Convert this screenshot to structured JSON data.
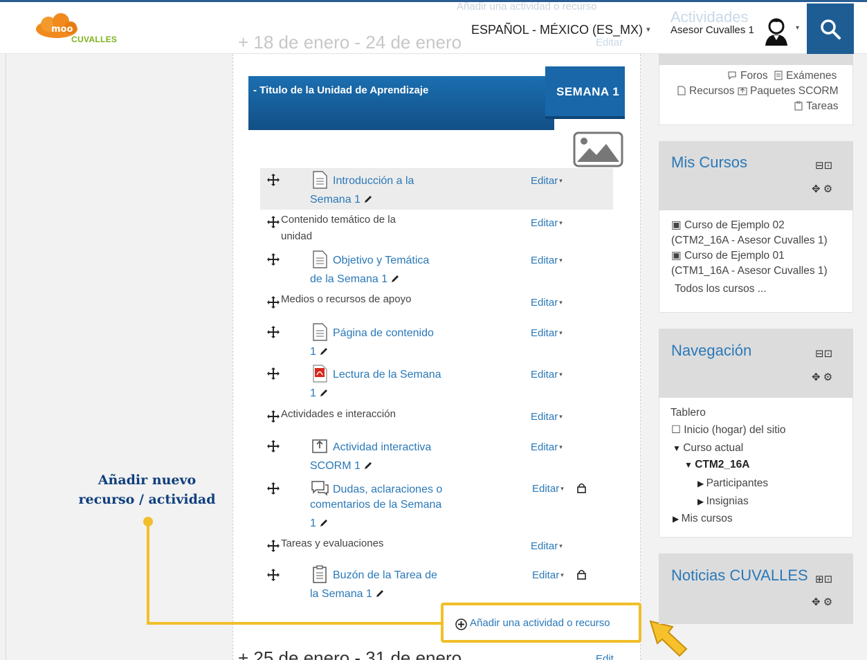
{
  "header": {
    "logo_text": "CUVALLES",
    "logo_badge": "moo",
    "language": "ESPAÑOL - MÉXICO (ES_MX)",
    "user_name": "Asesor Cuvalles 1",
    "faded_block_title": "Actividades",
    "faded_add_text": "Añadir una actividad o recurso"
  },
  "course": {
    "previous_week": "+ 18 de enero - 24 de enero",
    "previous_week_edit": "Editar",
    "unit_title": "- Titulo de la Unidad de Aprendizaje",
    "week_label": "SEMANA 1",
    "items": [
      {
        "kind": "resource",
        "line1": "Introducción a la",
        "line2": "Semana 1",
        "edit": "Editar"
      },
      {
        "kind": "label",
        "line1": "Contenido temático de la",
        "line2": "unidad",
        "edit": "Editar"
      },
      {
        "kind": "resource",
        "line1": "Objetivo y Temática",
        "line2": "de la Semana 1",
        "edit": "Editar"
      },
      {
        "kind": "label",
        "line1": "Medios o recursos de apoyo",
        "edit": "Editar"
      },
      {
        "kind": "resource",
        "line1": "Página de contenido",
        "line2": "1",
        "edit": "Editar"
      },
      {
        "kind": "resource",
        "line1": "Lectura de la Semana",
        "line2": "1",
        "edit": "Editar"
      },
      {
        "kind": "label",
        "line1": "Actividades e interacción",
        "edit": "Editar"
      },
      {
        "kind": "resource",
        "line1": "Actividad interactiva",
        "line2": "SCORM 1",
        "edit": "Editar"
      },
      {
        "kind": "resource",
        "line1": "Dudas, aclaraciones o",
        "line2": "comentarios de la Semana",
        "line3": "1",
        "edit": "Editar"
      },
      {
        "kind": "label",
        "line1": "Tareas y evaluaciones",
        "edit": "Editar"
      },
      {
        "kind": "resource",
        "line1": "Buzón de la Tarea de",
        "line2": "la Semana 1",
        "edit": "Editar"
      }
    ],
    "add_activity": "Añadir una actividad o recurso",
    "next_week": "+ 25 de enero - 31 de enero",
    "next_week_edit": "Edit"
  },
  "annotation": {
    "line1": "Añadir nuevo",
    "line2": "recurso / actividad"
  },
  "sidebar": {
    "activities": {
      "foros": "Foros",
      "examenes": "Exámenes",
      "recursos": "Recursos",
      "scorm": "Paquetes SCORM",
      "tareas": "Tareas"
    },
    "mis_cursos": {
      "title": "Mis Cursos",
      "course1_a": "Curso de Ejemplo 02",
      "course1_b": "(CTM2_16A - Asesor Cuvalles 1)",
      "course2_a": "Curso de Ejemplo 01",
      "course2_b": "(CTM1_16A - Asesor Cuvalles 1)",
      "all": "Todos los cursos ..."
    },
    "navegacion": {
      "title": "Navegación",
      "tablero": "Tablero",
      "inicio": "Inicio (hogar) del sitio",
      "curso_actual": "Curso actual",
      "ctm": "CTM2_16A",
      "participantes": "Participantes",
      "insignias": "Insignias",
      "mis_cursos": "Mis cursos"
    },
    "noticias": {
      "title": "Noticias CUVALLES"
    }
  },
  "colors": {
    "brand_blue": "#1d5d94",
    "link_blue": "#2a78b8",
    "highlight_yellow": "#f1bf2a",
    "logo_orange": "#f08a1c",
    "annotation_navy": "#0f3f7d"
  }
}
